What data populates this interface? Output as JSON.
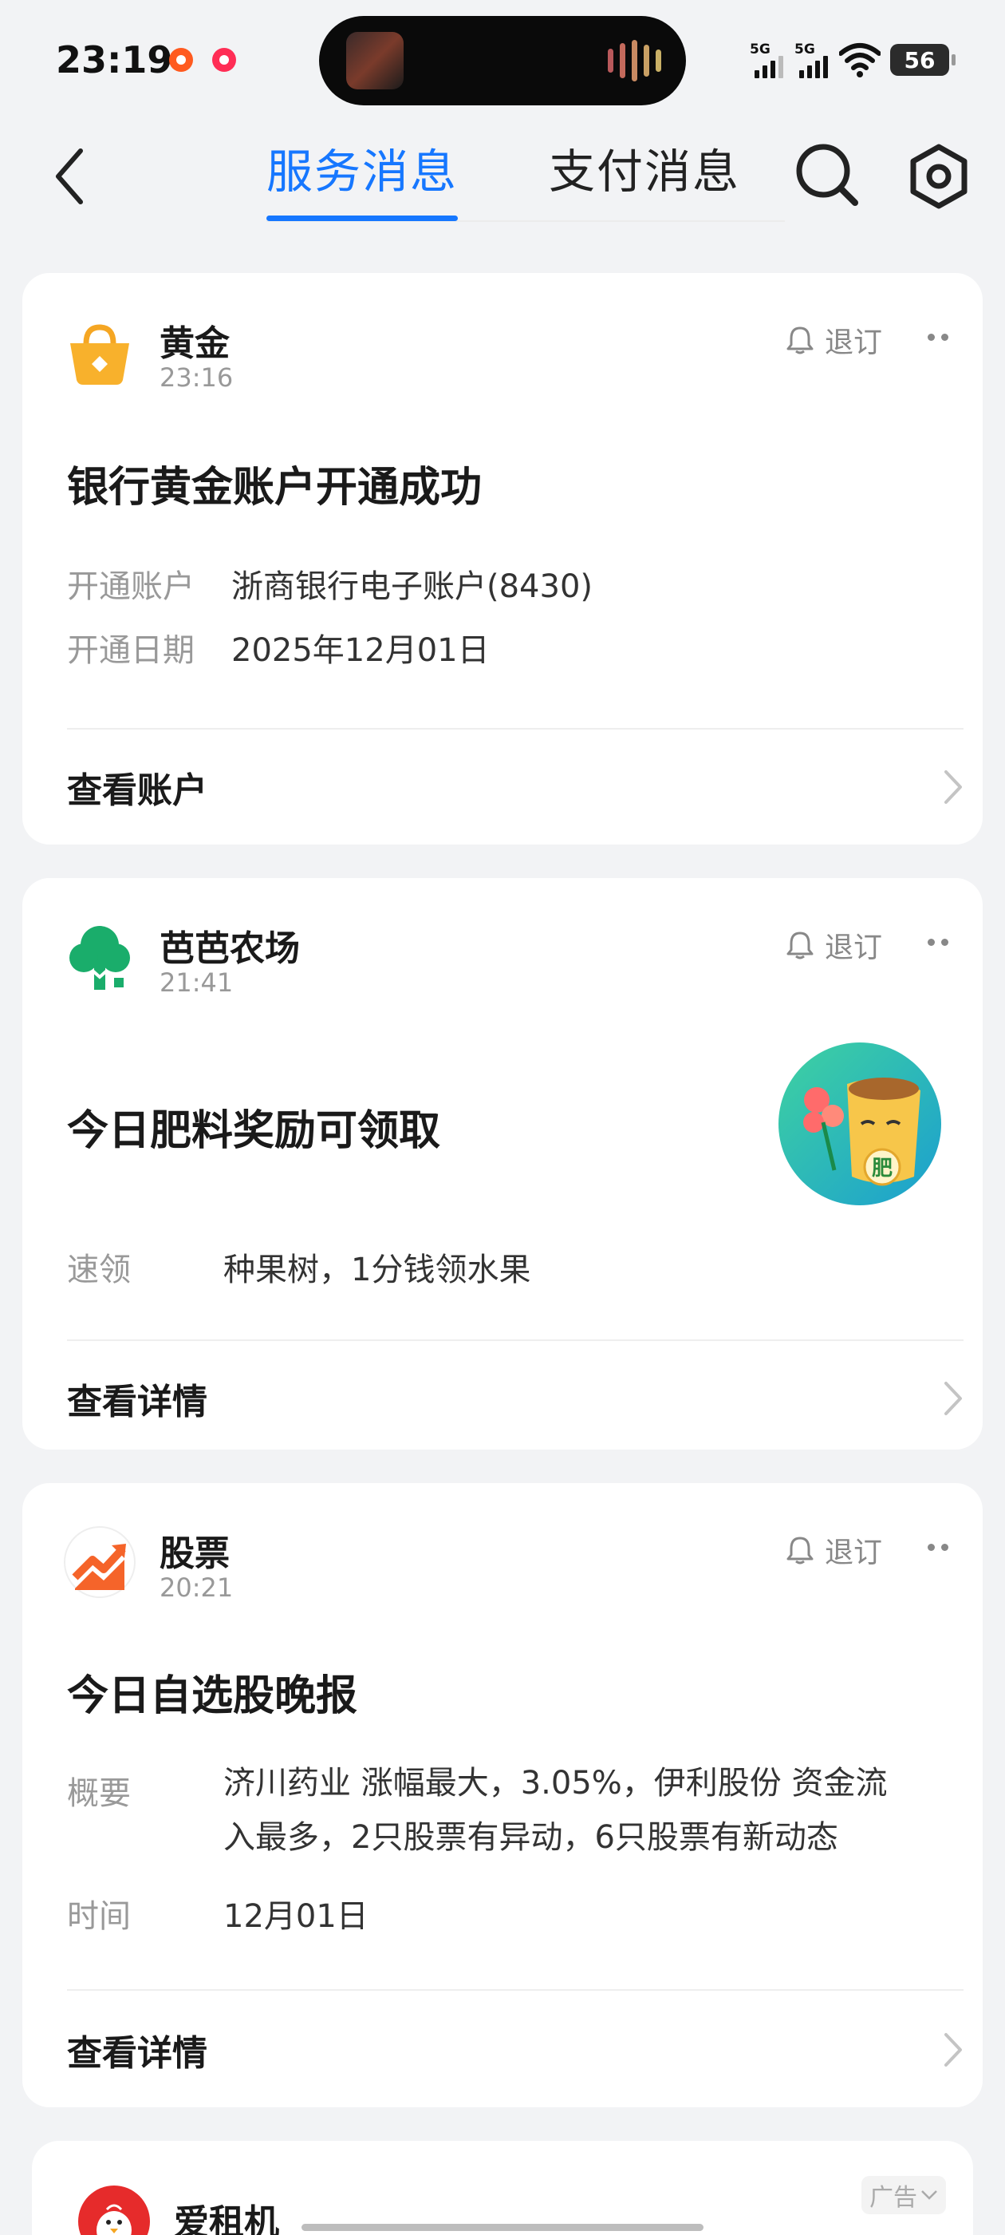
{
  "status_bar": {
    "time": "23:19",
    "signal1_label": "5G",
    "signal2_label": "5G",
    "battery": "56"
  },
  "header": {
    "tabs": [
      {
        "label": "服务消息",
        "active": true
      },
      {
        "label": "支付消息",
        "active": false
      }
    ],
    "accent_color": "#1677ff"
  },
  "cards": [
    {
      "source": "黄金",
      "time": "23:16",
      "unsubscribe_label": "退订",
      "title": "银行黄金账户开通成功",
      "rows": [
        {
          "key": "开通账户",
          "value": "浙商银行电子账户(8430)"
        },
        {
          "key": "开通日期",
          "value": "2025年12月01日"
        }
      ],
      "action_label": "查看账户",
      "icon": "gold-shopping-bag-icon"
    },
    {
      "source": "芭芭农场",
      "time": "21:41",
      "unsubscribe_label": "退订",
      "title": "今日肥料奖励可领取",
      "rows": [
        {
          "key": "速领",
          "value": "种果树，1分钱领水果"
        }
      ],
      "action_label": "查看详情",
      "icon": "tree-icon",
      "thumbnail_text": "肥"
    },
    {
      "source": "股票",
      "time": "20:21",
      "unsubscribe_label": "退订",
      "title": "今日自选股晚报",
      "rows": [
        {
          "key": "概要",
          "value_lines": [
            "济川药业 涨幅最大，3.05%，伊利股份 资金流",
            "入最多，2只股票有异动，6只股票有新动态"
          ]
        },
        {
          "key": "时间",
          "value": "12月01日"
        }
      ],
      "action_label": "查看详情",
      "icon": "stock-trend-icon"
    },
    {
      "source": "爱租机",
      "ad_label": "广告",
      "icon": "chick-avatar-icon"
    }
  ]
}
